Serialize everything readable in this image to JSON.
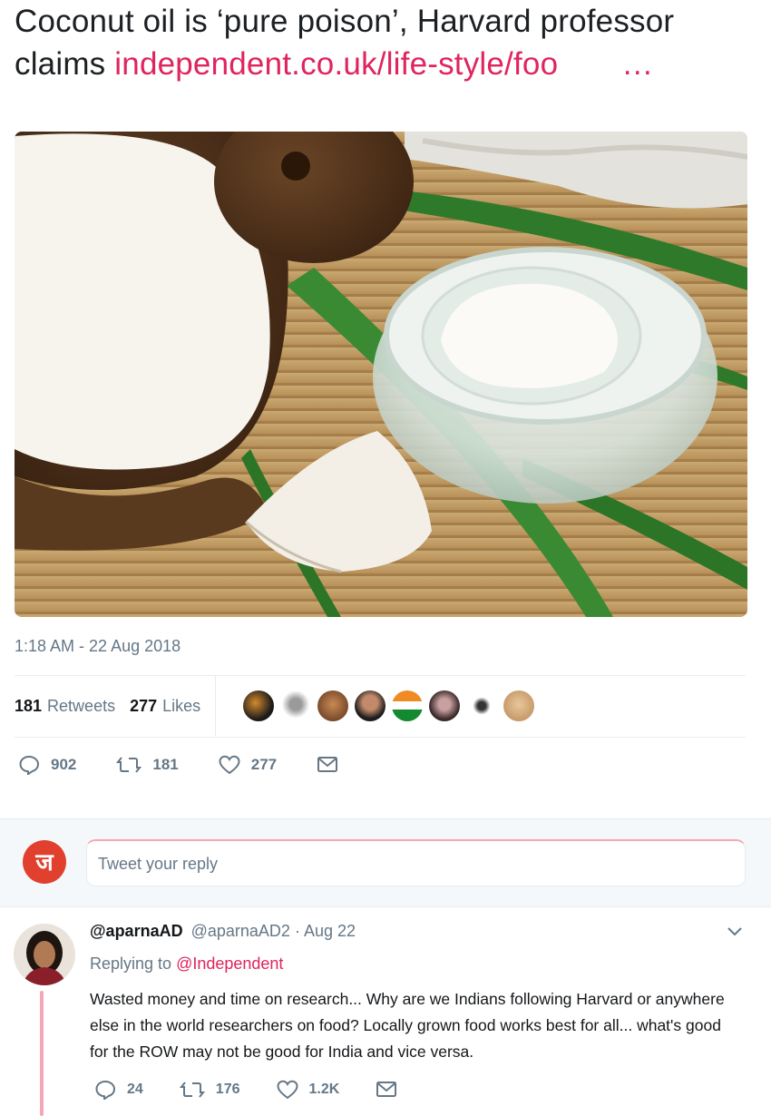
{
  "tweet": {
    "text": "Coconut oil is ‘pure poison’, Harvard professor claims ",
    "link": "independent.co.uk/life-style/foo",
    "ellipsis": "…",
    "timestamp": "1:18 AM - 22 Aug 2018",
    "retweets_count": "181",
    "retweets_label": "Retweets",
    "likes_count": "277",
    "likes_label": "Likes",
    "actions": {
      "replies": "902",
      "retweets": "181",
      "likes": "277"
    }
  },
  "reply_box": {
    "placeholder": "Tweet your reply"
  },
  "reply": {
    "display_name": "@aparnaAD",
    "handle": "@aparnaAD2",
    "date": "· Aug 22",
    "replying_to_label": "Replying to ",
    "replying_to_mention": "@Independent",
    "body": "Wasted money and time on research... Why are we Indians following Harvard or anywhere else in the world researchers on food? Locally grown food works best for all... what's good for the ROW may not be good for India and vice versa.",
    "actions": {
      "replies": "24",
      "retweets": "176",
      "likes": "1.2K"
    }
  },
  "colors": {
    "accent": "#e0245e",
    "muted": "#657786",
    "thread_line": "#f3a7b8"
  }
}
